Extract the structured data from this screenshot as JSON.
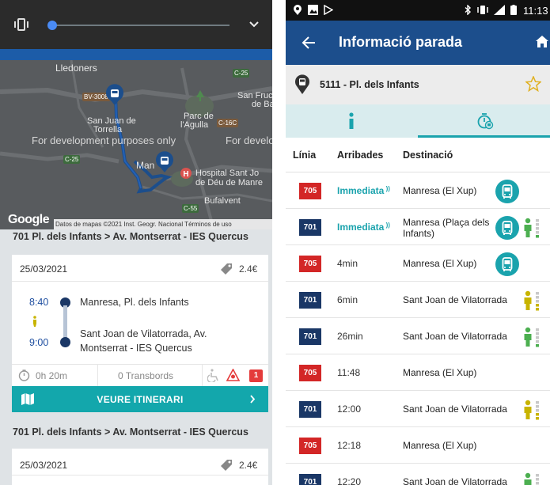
{
  "left": {
    "map": {
      "dev_text_1": "For development purposes only",
      "dev_text_2": "For develo",
      "places": [
        "Lledoners",
        "San Fruc",
        "de Ba",
        "Parc de",
        "l'Agulla",
        "San Juan de",
        "Torrella",
        "Man",
        "esa",
        "Hospital Sant Jo",
        "de Déu de Manre",
        "Bufalvent"
      ],
      "roads": [
        "BV-3008",
        "C-25",
        "C-16C",
        "C-25",
        "C-55"
      ],
      "google": "Google",
      "attribution": "Datos de mapas ©2021 Inst. Geogr. Nacional  Términos de uso"
    },
    "route_title_1": "701 Pl. dels Infants > Av. Montserrat - IES Quercus",
    "route_title_2": "701 Pl. dels Infants > Av. Montserrat - IES Quercus",
    "card1": {
      "date": "25/03/2021",
      "price": "2.4€",
      "dep_time": "8:40",
      "dep_place": "Manresa, Pl. dels Infants",
      "arr_time": "9:00",
      "arr_place_1": "Sant Joan de Vilatorrada, Av.",
      "arr_place_2": "Montserrat - IES Quercus",
      "duration": "0h 20m",
      "transfers": "0 Transbords",
      "alerts": "1",
      "button": "VEURE ITINERARI"
    },
    "card2": {
      "date": "25/03/2021",
      "price": "2.4€"
    }
  },
  "right": {
    "status_time": "11:13",
    "title": "Informació parada",
    "stop": "5111 - Pl. dels Infants",
    "headers": {
      "line": "Línia",
      "arrivals": "Arribades",
      "destination": "Destinació"
    },
    "rows": [
      {
        "line": "705",
        "arrival": "Immediata",
        "destination": "Manresa (El Xup)",
        "accessible": true,
        "occupancy": ""
      },
      {
        "line": "701",
        "arrival": "Immediata",
        "destination": "Manresa (Plaça dels Infants)",
        "accessible": true,
        "occupancy": "low"
      },
      {
        "line": "705",
        "arrival": "4min",
        "destination": "Manresa (El Xup)",
        "accessible": true,
        "occupancy": ""
      },
      {
        "line": "701",
        "arrival": "6min",
        "destination": "Sant Joan de Vilatorrada",
        "accessible": false,
        "occupancy": "medium"
      },
      {
        "line": "701",
        "arrival": "26min",
        "destination": "Sant Joan de Vilatorrada",
        "accessible": false,
        "occupancy": "low"
      },
      {
        "line": "705",
        "arrival": "11:48",
        "destination": "Manresa (El Xup)",
        "accessible": false,
        "occupancy": ""
      },
      {
        "line": "701",
        "arrival": "12:00",
        "destination": "Sant Joan de Vilatorrada",
        "accessible": false,
        "occupancy": "medium"
      },
      {
        "line": "705",
        "arrival": "12:18",
        "destination": "Manresa (El Xup)",
        "accessible": false,
        "occupancy": ""
      },
      {
        "line": "701",
        "arrival": "12:20",
        "destination": "Sant Joan de Vilatorrada",
        "accessible": false,
        "occupancy": "low"
      }
    ],
    "colors": {
      "line_705": "#d32626",
      "line_701": "#1a3766",
      "accent": "#1aa3ad",
      "appbar": "#1c4e8c",
      "occ_low": "#4caf50",
      "occ_medium": "#c8b400"
    }
  }
}
